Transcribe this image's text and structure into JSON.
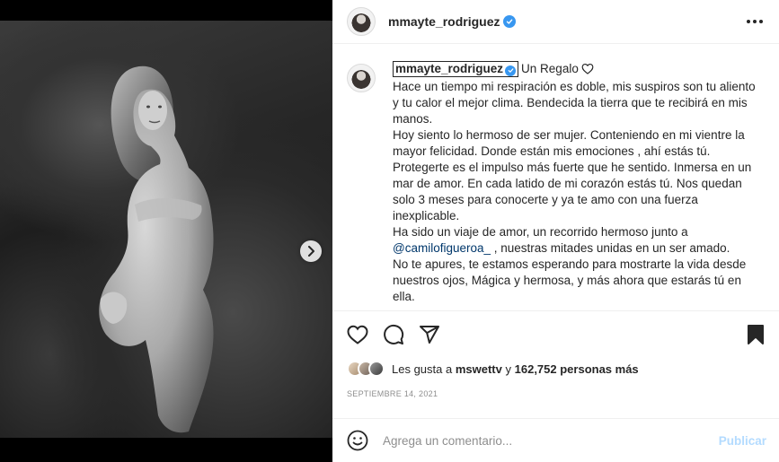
{
  "post": {
    "username": "mmayte_rodriguez",
    "verified": true,
    "more_icon": "ellipsis-icon",
    "media": {
      "description_icon": "photo",
      "carousel_dots": 3,
      "active_dot": 0,
      "next_icon": "chevron-right-icon"
    }
  },
  "caption": {
    "username": "mmayte_rodriguez",
    "title": "Un Regalo",
    "lines": [
      "Hace un tiempo mi respiración es doble, mis suspiros son tu aliento y tu calor el mejor clima. Bendecida la tierra que te recibirá en mis manos.",
      "Hoy siento lo hermoso de ser mujer. Conteniendo en mi vientre la mayor felicidad. Donde están mis emociones , ahí estás tú. Protegerte es el impulso más fuerte que he sentido. Inmersa en un mar de amor. En cada latido de mi corazón estás tú. Nos quedan solo 3 meses para conocerte y ya te amo con una fuerza inexplicable.",
      "Ha sido un viaje de amor, un recorrido hermoso junto a",
      "@camilofigueroa_",
      ", nuestras mitades unidas en un ser amado.",
      "No te apures, te estamos esperando para mostrarte la vida desde nuestros ojos, Mágica y hermosa, y más ahora que estarás tú en ella."
    ]
  },
  "actions": {
    "like_icon": "heart-icon",
    "comment_icon": "comment-icon",
    "share_icon": "paper-plane-icon",
    "save_icon": "bookmark-icon"
  },
  "likes": {
    "prefix": "Les gusta a",
    "user": "mswettv",
    "connector": "y",
    "count": "162,752 personas más"
  },
  "date": "SEPTIEMBRE 14, 2021",
  "comment": {
    "placeholder": "Agrega un comentario...",
    "publish_label": "Publicar",
    "emoji_icon": "smiley-icon"
  },
  "colors": {
    "accent": "#3897f0",
    "publish_disabled": "#b3dbff",
    "muted": "#8e8e8e"
  }
}
